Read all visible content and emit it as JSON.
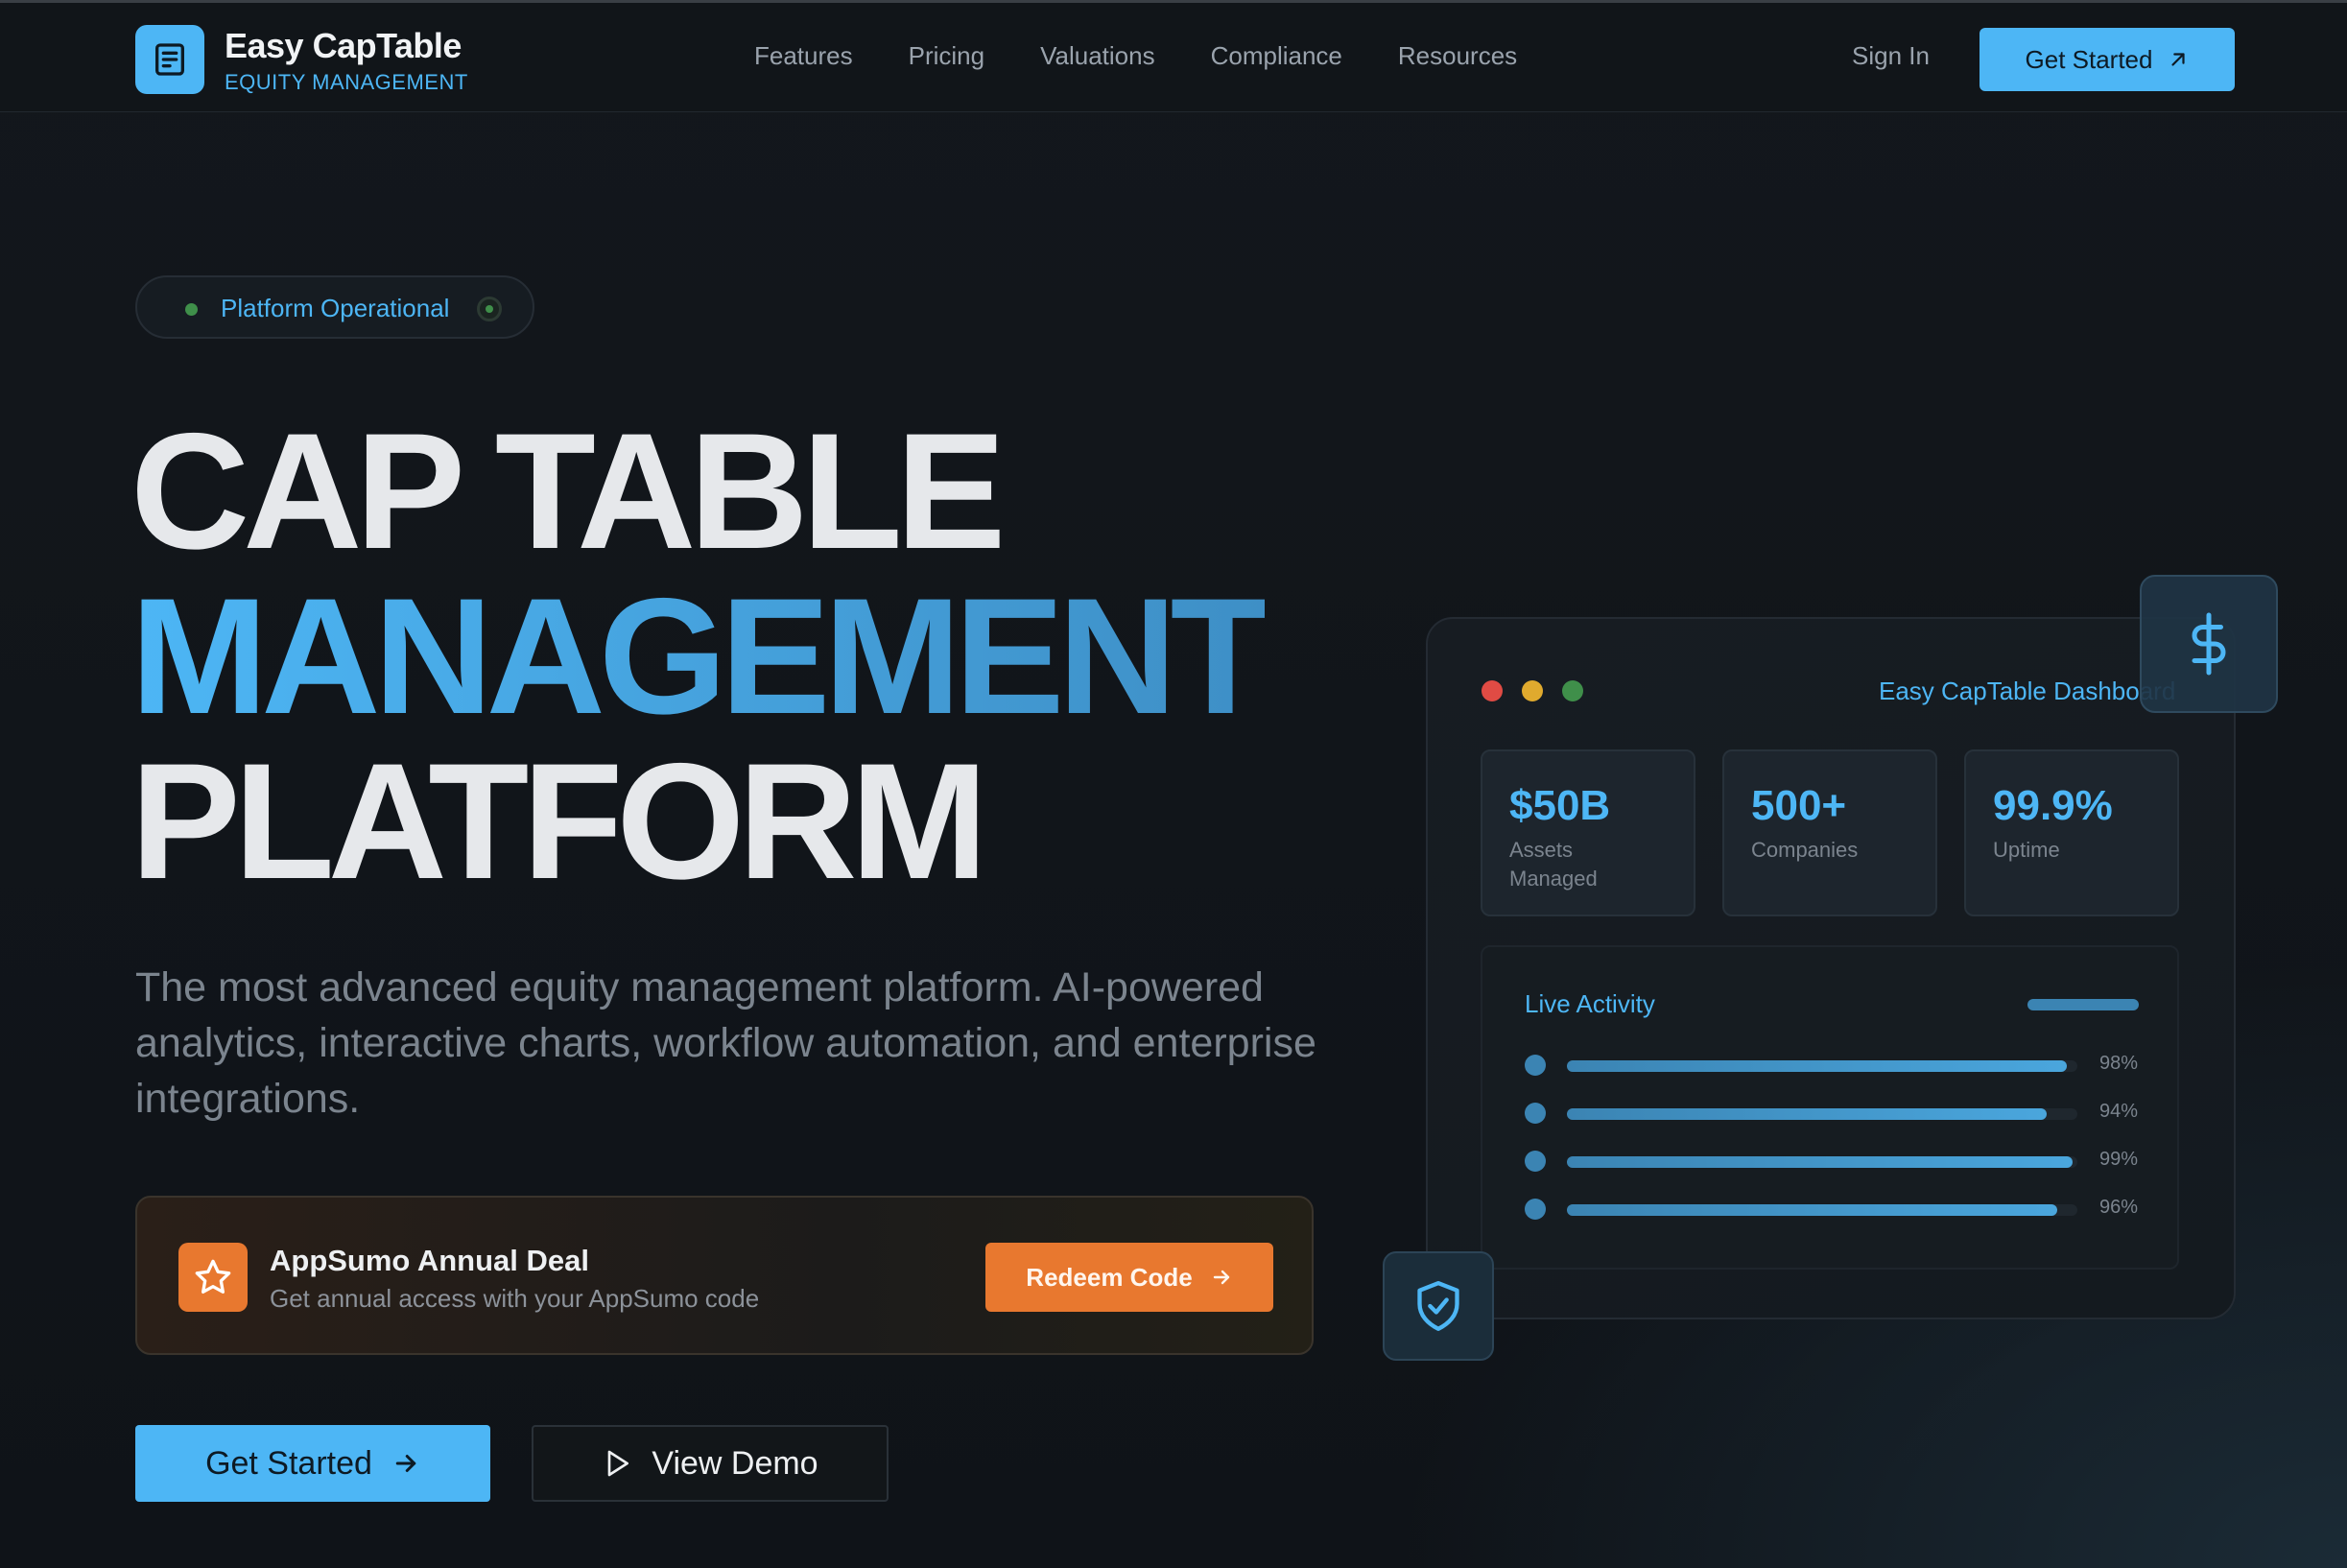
{
  "brand": {
    "name": "Easy CapTable",
    "tagline": "EQUITY MANAGEMENT"
  },
  "nav": {
    "links": [
      "Features",
      "Pricing",
      "Valuations",
      "Compliance",
      "Resources"
    ],
    "sign_in": "Sign In",
    "cta": "Get Started"
  },
  "status": {
    "label": "Platform Operational"
  },
  "hero": {
    "line1": "CAP TABLE",
    "line2": "MANAGEMENT",
    "line3": "PLATFORM",
    "description": "The most advanced equity management platform. AI-powered analytics, interactive charts, workflow automation, and enterprise integrations."
  },
  "deal": {
    "title": "AppSumo Annual Deal",
    "subtitle": "Get annual access with your AppSumo code",
    "button": "Redeem Code"
  },
  "ctas": {
    "primary": "Get Started",
    "secondary": "View Demo"
  },
  "dashboard": {
    "title": "Easy CapTable Dashboard",
    "window_dots": [
      "#e04b44",
      "#e0aa2e",
      "#3f8f4a"
    ],
    "stats": [
      {
        "value": "$50B",
        "label": "Assets Managed"
      },
      {
        "value": "500+",
        "label": "Companies"
      },
      {
        "value": "99.9%",
        "label": "Uptime"
      }
    ],
    "activity": {
      "title": "Live Activity",
      "rows": [
        {
          "percent": 98,
          "label": "98%"
        },
        {
          "percent": 94,
          "label": "94%"
        },
        {
          "percent": 99,
          "label": "99%"
        },
        {
          "percent": 96,
          "label": "96%"
        }
      ]
    }
  },
  "icons": {
    "logo": "document-icon",
    "nav_cta": "arrow-up-right-icon",
    "deal": "star-icon",
    "redeem": "arrow-right-icon",
    "primary": "arrow-right-icon",
    "secondary": "play-icon",
    "float_top": "dollar-icon",
    "float_bottom": "shield-check-icon"
  },
  "colors": {
    "accent": "#4db6f5",
    "deal": "#e8782f",
    "background": "#101419"
  }
}
